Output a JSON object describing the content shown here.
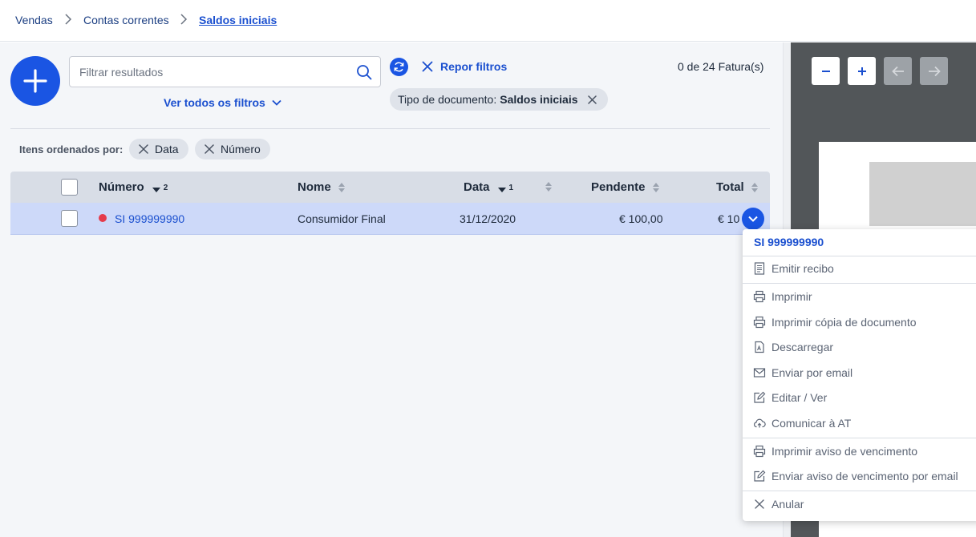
{
  "breadcrumb": {
    "items": [
      "Vendas",
      "Contas correntes"
    ],
    "current": "Saldos iniciais"
  },
  "toolbar": {
    "search_placeholder": "Filtrar resultados",
    "see_all_filters": "Ver todos os filtros",
    "reset_filters": "Repor filtros",
    "invoice_count": "0 de 24 Fatura(s)",
    "filter_chip": {
      "label": "Tipo de documento:",
      "value": "Saldos iniciais"
    }
  },
  "sorting": {
    "label": "Itens ordenados por:",
    "chips": [
      "Data",
      "Número"
    ]
  },
  "table": {
    "columns": {
      "number": "Número",
      "number_sort_index": "2",
      "name": "Nome",
      "date": "Data",
      "date_sort_index": "1",
      "pending": "Pendente",
      "total": "Total"
    },
    "rows": [
      {
        "number": "SI 999999990",
        "name": "Consumidor Final",
        "date": "31/12/2020",
        "pending": "€ 100,00",
        "total": "€ 10"
      }
    ]
  },
  "row_menu": {
    "title": "SI 999999990",
    "items": [
      {
        "label": "Emitir recibo",
        "icon": "receipt-icon"
      },
      {
        "label": "Imprimir",
        "icon": "printer-icon"
      },
      {
        "label": "Imprimir cópia de documento",
        "icon": "printer-icon"
      },
      {
        "label": "Descarregar",
        "icon": "pdf-download-icon"
      },
      {
        "label": "Enviar por email",
        "icon": "email-icon"
      },
      {
        "label": "Editar / Ver",
        "icon": "edit-icon"
      },
      {
        "label": "Comunicar à AT",
        "icon": "cloud-upload-icon"
      },
      {
        "label": "Imprimir aviso de vencimento",
        "icon": "printer-icon"
      },
      {
        "label": "Enviar aviso de vencimento por email",
        "icon": "edit-icon"
      },
      {
        "label": "Anular",
        "icon": "close-icon"
      }
    ]
  },
  "viewer": {
    "controls": [
      {
        "symbol": "−",
        "icon": "zoom-out-icon",
        "enabled": true
      },
      {
        "symbol": "+",
        "icon": "zoom-in-icon",
        "enabled": true
      },
      {
        "symbol": "←",
        "icon": "previous-page-icon",
        "enabled": false
      },
      {
        "symbol": "→",
        "icon": "next-page-icon",
        "enabled": false
      }
    ]
  },
  "colors": {
    "primary": "#1a55e3",
    "link": "#1a4fcf",
    "selected_row": "#cdd9f9",
    "status_dot": "#e53b4b",
    "viewer_bg": "#525659"
  }
}
